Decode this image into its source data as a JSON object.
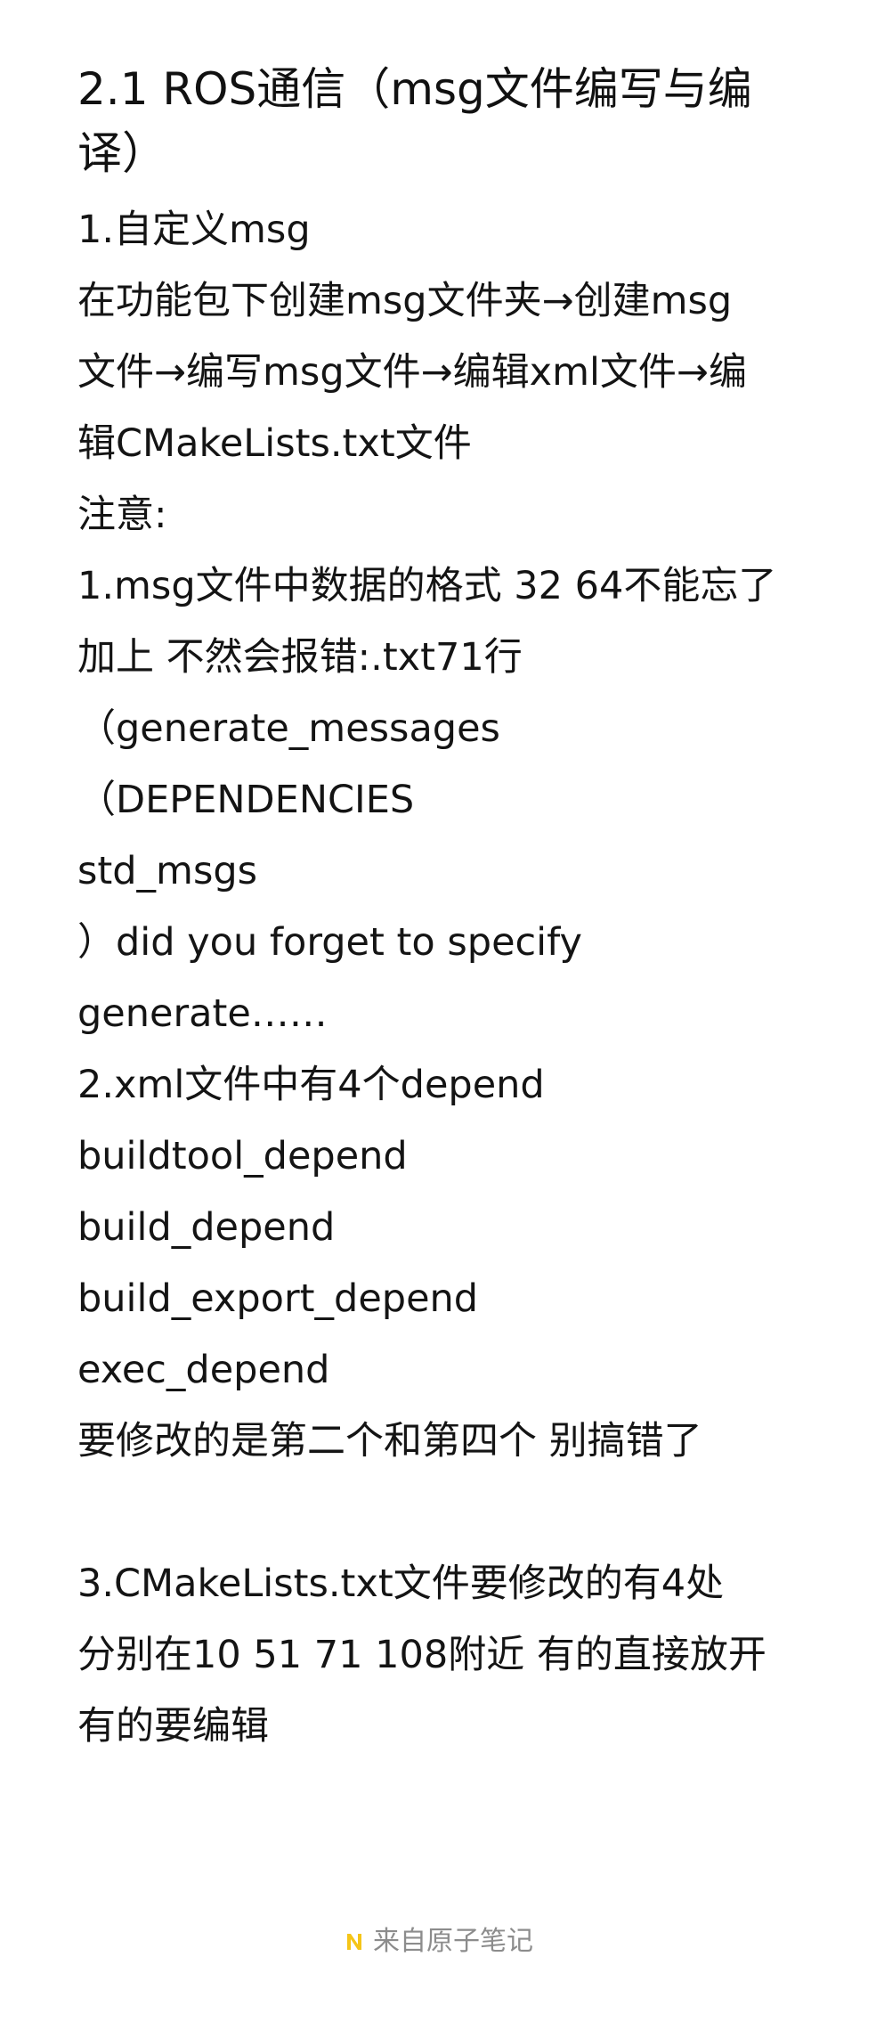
{
  "document": {
    "title": "2.1 ROS通信（msg文件编写与编译）",
    "lines": [
      "1.自定义msg",
      "在功能包下创建msg文件夹→创建msg",
      "文件→编写msg文件→编辑xml文件→编",
      "辑CMakeLists.txt文件",
      "注意:",
      "1.msg文件中数据的格式 32 64不能忘了",
      "加上 不然会报错:.txt71行",
      "（generate_messages",
      "（DEPENDENCIES",
      "std_msgs",
      "）did you forget to specify",
      "generate……",
      "2.xml文件中有4个depend",
      "buildtool_depend",
      "build_depend",
      "build_export_depend",
      "exec_depend",
      "要修改的是第二个和第四个 别搞错了",
      "",
      "3.CMakeLists.txt文件要修改的有4处",
      "分别在10 51 71 108附近 有的直接放开",
      "有的要编辑"
    ]
  },
  "footer": {
    "icon": "notes-app-logo-icon",
    "text": "来自原子笔记",
    "color": "#8c8c8c",
    "accent": "#f5c518"
  }
}
